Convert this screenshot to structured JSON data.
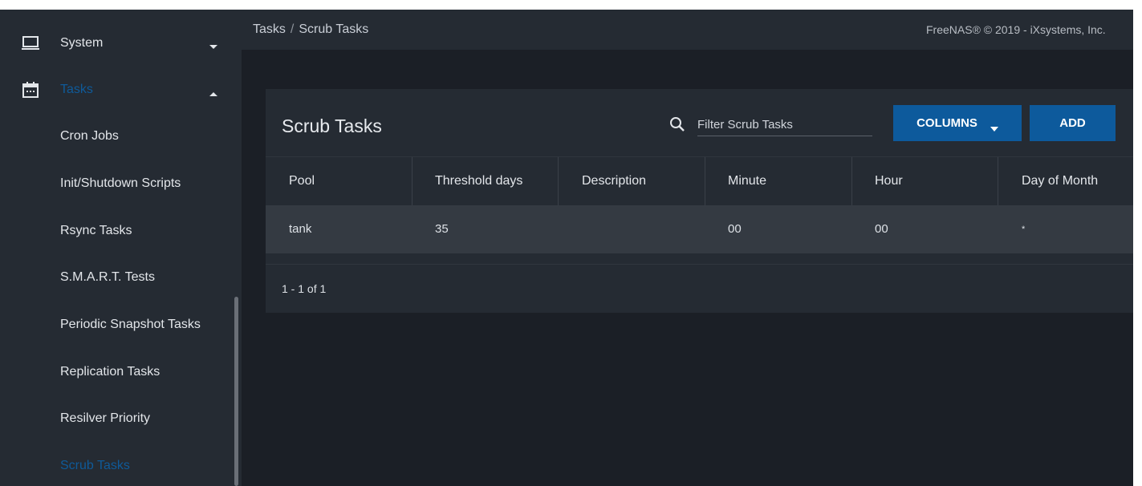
{
  "sidebar": {
    "system": {
      "label": "System",
      "icon": "laptop-icon"
    },
    "tasks": {
      "label": "Tasks",
      "icon": "calendar-icon"
    },
    "items": [
      {
        "label": "Cron Jobs"
      },
      {
        "label": "Init/Shutdown Scripts"
      },
      {
        "label": "Rsync Tasks"
      },
      {
        "label": "S.M.A.R.T. Tests"
      },
      {
        "label": "Periodic Snapshot Tasks"
      },
      {
        "label": "Replication Tasks"
      },
      {
        "label": "Resilver Priority"
      },
      {
        "label": "Scrub Tasks"
      }
    ],
    "active_color": "#0f5a99"
  },
  "topbar": {
    "breadcrumb_root": "Tasks",
    "breadcrumb_sep": "/",
    "breadcrumb_current": "Scrub Tasks",
    "copyright": "FreeNAS® © 2019 - iXsystems, Inc."
  },
  "card": {
    "title": "Scrub Tasks",
    "filter_placeholder": "Filter Scrub Tasks",
    "columns_label": "COLUMNS",
    "add_label": "ADD",
    "button_color": "#0d5a9c"
  },
  "table": {
    "headers": [
      "Pool",
      "Threshold days",
      "Description",
      "Minute",
      "Hour",
      "Day of Month"
    ],
    "rows": [
      [
        "tank",
        "35",
        "",
        "00",
        "00",
        "*"
      ]
    ]
  },
  "paginator": {
    "label": "1 - 1 of 1"
  }
}
